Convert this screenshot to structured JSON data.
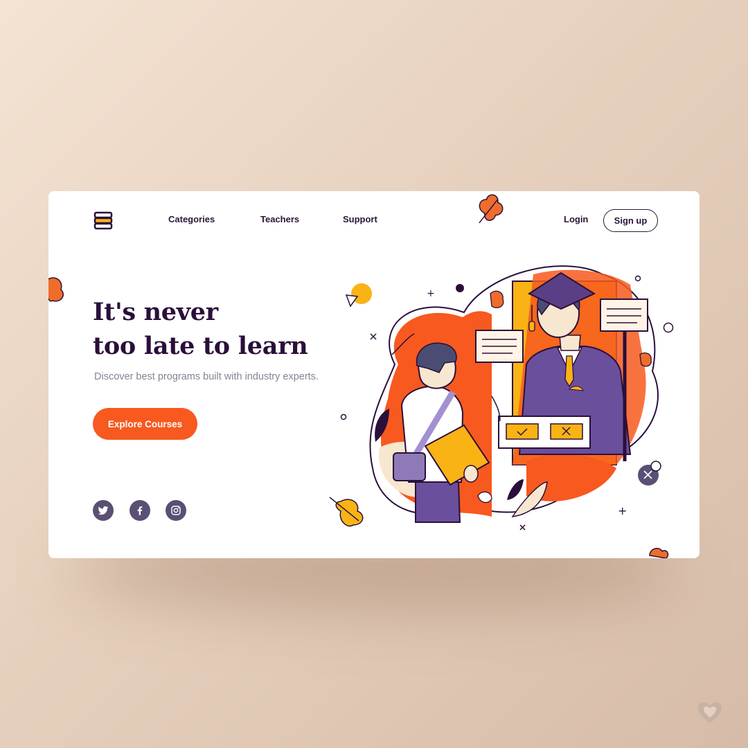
{
  "header": {
    "logo_icon": "stacked-books-icon",
    "nav": [
      {
        "label": "Categories"
      },
      {
        "label": "Teachers"
      },
      {
        "label": "Support"
      }
    ],
    "login_label": "Login",
    "signup_label": "Sign up"
  },
  "hero": {
    "headline_line1": "It's never",
    "headline_line2": "too late to learn",
    "subtitle": "Discover best programs built with industry experts.",
    "cta_label": "Explore Courses"
  },
  "social": [
    {
      "icon": "twitter-icon"
    },
    {
      "icon": "facebook-icon"
    },
    {
      "icon": "instagram-icon"
    }
  ],
  "colors": {
    "accent": "#f7591f",
    "text_dark": "#2a0f3a",
    "social_bg": "#5a4f74",
    "purple": "#6a4f9c",
    "yellow": "#f9b315",
    "background": "#eed9c7"
  }
}
